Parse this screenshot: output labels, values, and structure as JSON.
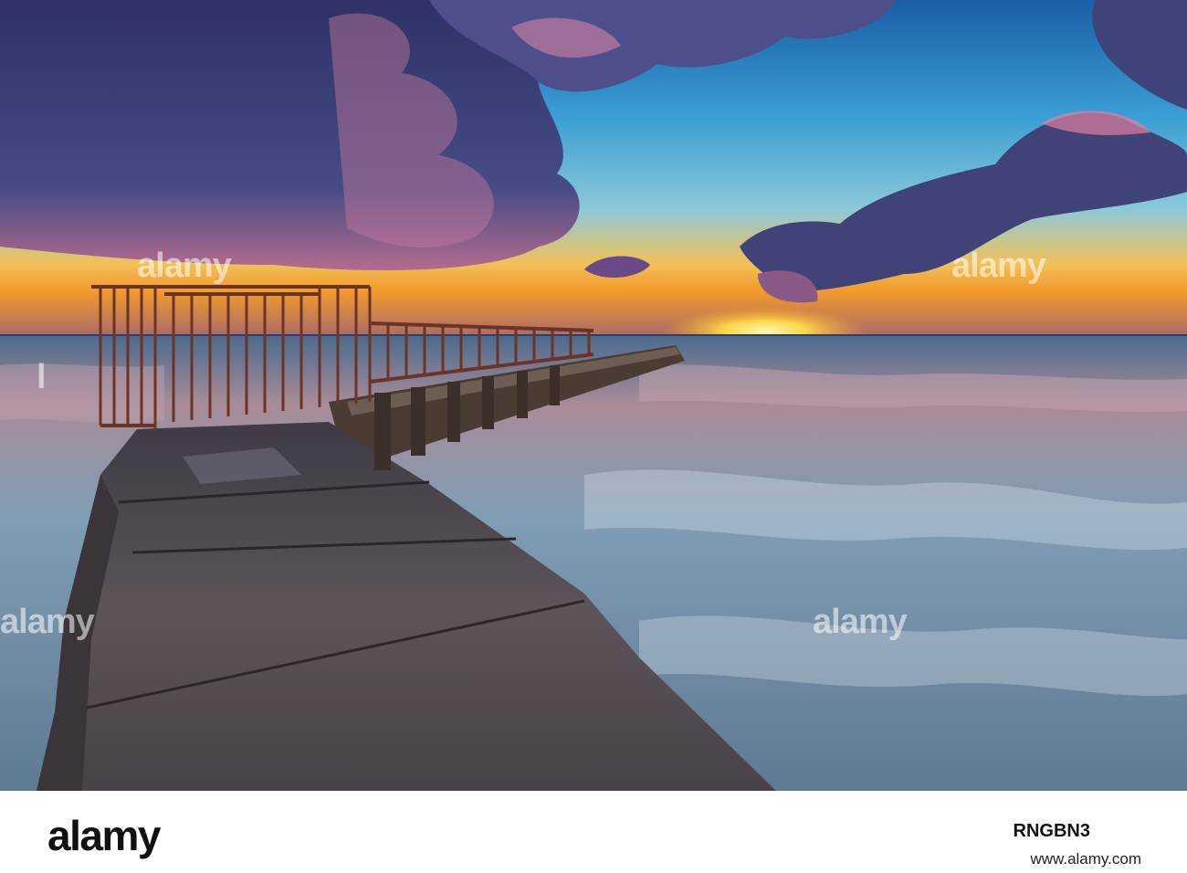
{
  "photo": {
    "scene": "sunset-pier-seascape",
    "colors": {
      "sky_top": "#1f6fb8",
      "sky_mid": "#3fa6d6",
      "horizon_glow": "#f5b233",
      "sun": "#ffd84a",
      "cloud_dark": "#3a3d72",
      "cloud_pink": "#d47a9a",
      "water": "#6a8aa6",
      "pier_concrete": "#5a5258",
      "railing": "#6b3428"
    }
  },
  "watermark": {
    "text": "alamy"
  },
  "footer": {
    "logo": "alamy",
    "image_id": "RNGBN3",
    "url": "www.alamy.com"
  }
}
